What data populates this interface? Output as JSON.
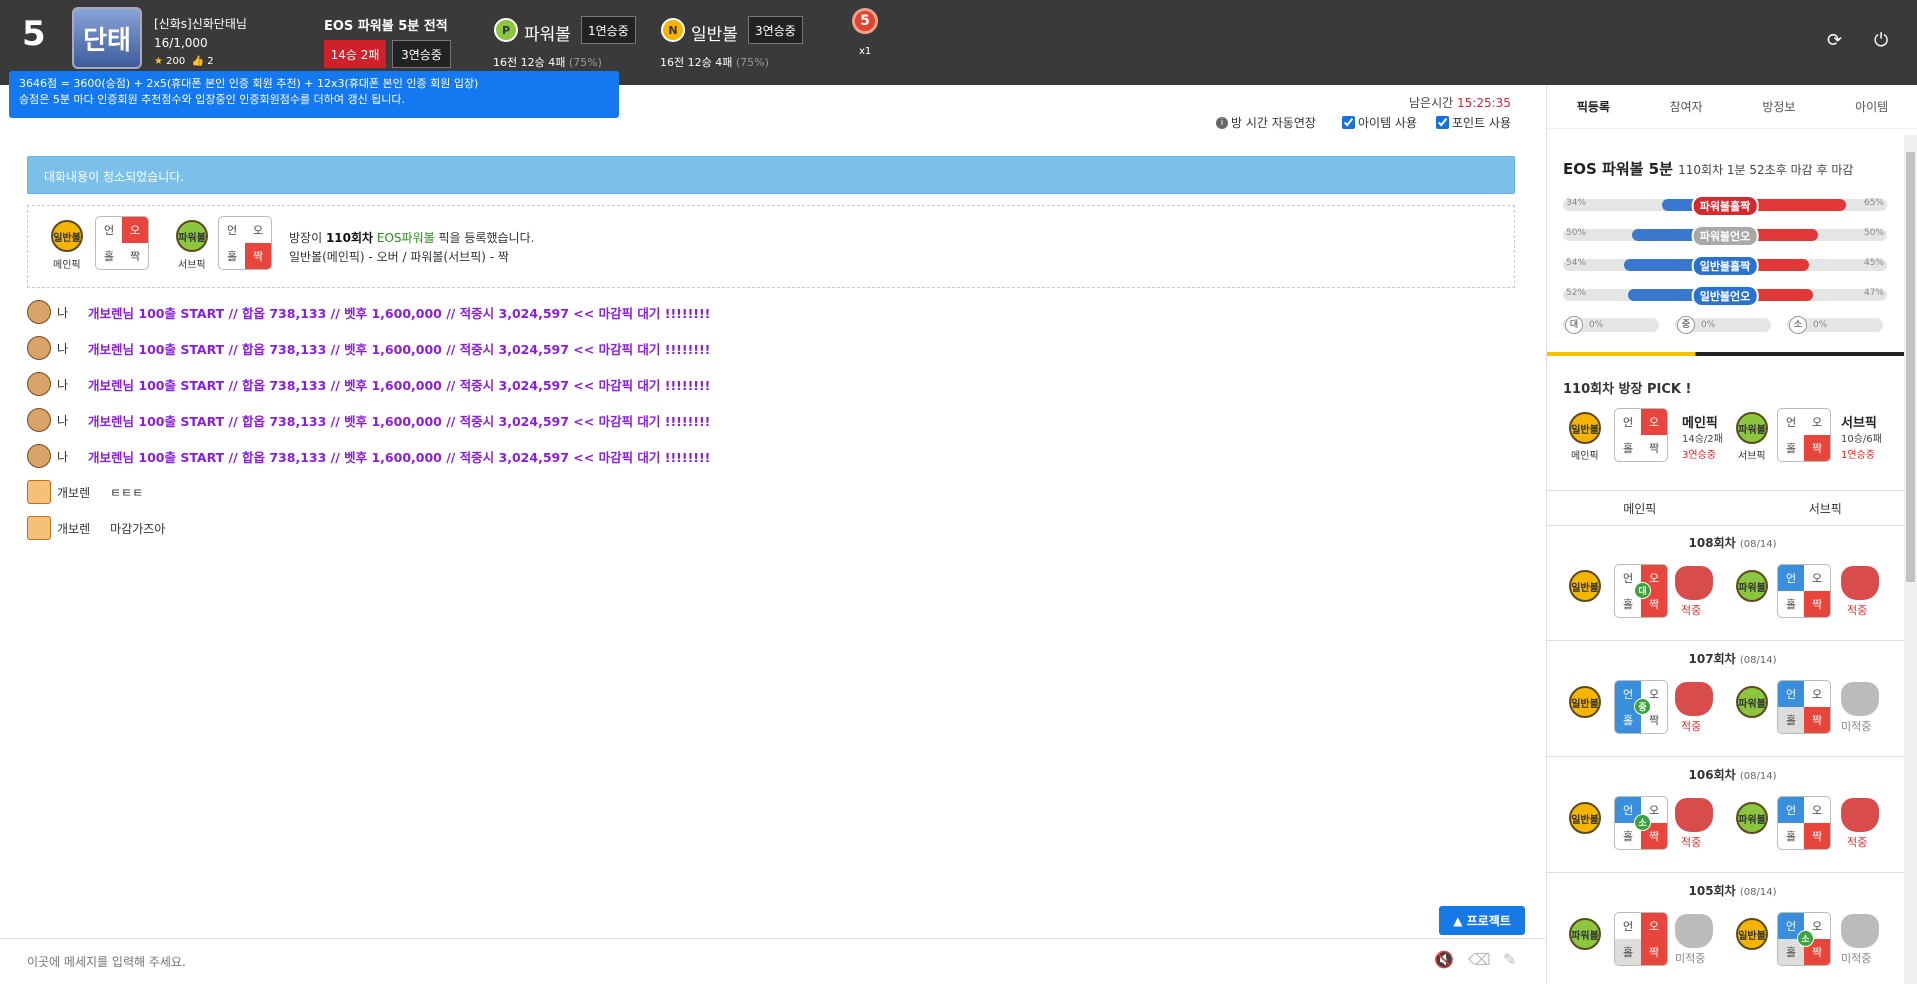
{
  "header": {
    "room_number": "5",
    "room_logo_text": "단태",
    "room_name": "[신화s]신화단태님",
    "member_count": "16/1,000",
    "stars": "200",
    "likes": "2",
    "record_title": "EOS 파워볼 5분 전적",
    "record_win_loss": "14승 2패",
    "record_streak": "3연승중",
    "powerball": {
      "icon": "P",
      "label": "파워볼",
      "streak": "1연승중",
      "record": "16전 12승 4패",
      "pct": "(75%)"
    },
    "normalball": {
      "icon": "N",
      "label": "일반볼",
      "streak": "3연승중",
      "record": "16전 12승 4패",
      "pct": "(75%)"
    },
    "medal_number": "5",
    "medal_count": "x1",
    "refresh_icon": "refresh-icon",
    "power_icon": "power-icon"
  },
  "tooltip": {
    "line1": "3646점 = 3600(승점) + 2x5(휴대폰 본인 인증 회원 추천) + 12x3(휴대폰 본인 인증 회원 입장)",
    "line2": "승점은 5분 마다 인증회원 추천점수와 입장중인 인증회원점수를 더하여 갱신 됩니다."
  },
  "subbar": {
    "time_label": "남은시간",
    "time_value": "15:25:35",
    "auto_extend": "방 시간 자동연장",
    "item_use": "아이템 사용",
    "point_use": "포인트 사용"
  },
  "chat": {
    "notice": "대화내용이 청소되었습니다.",
    "pick_box": {
      "main_tag": "일반볼",
      "main_caption": "메인픽",
      "sub_tag": "파워볼",
      "sub_caption": "서브픽",
      "grid_labels": [
        "언",
        "오",
        "홀",
        "짝"
      ],
      "msg_prefix": "방장이 ",
      "msg_round": "110회차",
      "msg_game": "EOS파워볼",
      "msg_suffix": " 픽을 등록했습니다.",
      "msg_line2": "일반볼(메인픽) - 오버 / 파워볼(서브픽) - 짝"
    },
    "messages": [
      {
        "nick": "나",
        "text": "개보렌님 100출 START // 합옵 738,133 // 벳후 1,600,000 // 적중시 3,024,597 << 마감픽 대기 !!!!!!!!",
        "style": "purple"
      },
      {
        "nick": "나",
        "text": "개보렌님 100출 START // 합옵 738,133 // 벳후 1,600,000 // 적중시 3,024,597 << 마감픽 대기 !!!!!!!!",
        "style": "purple"
      },
      {
        "nick": "나",
        "text": "개보렌님 100출 START // 합옵 738,133 // 벳후 1,600,000 // 적중시 3,024,597 << 마감픽 대기 !!!!!!!!",
        "style": "purple"
      },
      {
        "nick": "나",
        "text": "개보렌님 100출 START // 합옵 738,133 // 벳후 1,600,000 // 적중시 3,024,597 << 마감픽 대기 !!!!!!!!",
        "style": "purple"
      },
      {
        "nick": "나",
        "text": "개보렌님 100출 START // 합옵 738,133 // 벳후 1,600,000 // 적중시 3,024,597 << 마감픽 대기 !!!!!!!!",
        "style": "purple"
      },
      {
        "nick": "개보렌",
        "text": "ㅌㅌㅌ",
        "style": "normal"
      },
      {
        "nick": "개보렌",
        "text": "마감가즈아",
        "style": "normal"
      }
    ],
    "project_button": "▲ 프로젝트",
    "input_placeholder": "이곳에 메세지를 입력해 주세요."
  },
  "right_panel": {
    "tabs": [
      "픽등록",
      "참여자",
      "방정보",
      "아이템"
    ],
    "active_tab": "픽등록",
    "game_title": "EOS 파워볼 5분",
    "game_sub": "110회차 1분 52초후 마감 후 마감",
    "bars": [
      {
        "label": "파워볼홀짝",
        "left_pct": 34,
        "right_pct": 65,
        "left": "34%",
        "right": "65%",
        "color": "#d8282e"
      },
      {
        "label": "파워볼언오",
        "left_pct": 50,
        "right_pct": 50,
        "left": "50%",
        "right": "50%",
        "color": "#a8a8a8"
      },
      {
        "label": "일반볼홀짝",
        "left_pct": 54,
        "right_pct": 45,
        "left": "54%",
        "right": "45%",
        "color": "#2a72d0"
      },
      {
        "label": "일반볼언오",
        "left_pct": 52,
        "right_pct": 47,
        "left": "52%",
        "right": "47%",
        "color": "#2a72d0"
      }
    ],
    "mini_bars": [
      {
        "icon": "대",
        "value": "0%"
      },
      {
        "icon": "중",
        "value": "0%"
      },
      {
        "icon": "소",
        "value": "0%"
      }
    ],
    "owner_pick_title": "110회차 방장 PICK !",
    "owner_main": {
      "tag": "일반볼",
      "caption": "메인픽",
      "name": "메인픽",
      "record": "14승/2패",
      "streak": "3연승중"
    },
    "owner_sub": {
      "tag": "파워볼",
      "caption": "서브픽",
      "name": "서브픽",
      "record": "10승/6패",
      "streak": "1연승중"
    },
    "pick_head": [
      "메인픽",
      "서브픽"
    ],
    "rounds": [
      {
        "title": "108회차",
        "date": "(08/14)",
        "main_tag": "일반볼",
        "main_badge": "대",
        "main_result": "적중",
        "sub_tag": "파워볼",
        "sub_result": "적중"
      },
      {
        "title": "107회차",
        "date": "(08/14)",
        "main_tag": "일반볼",
        "main_badge": "중",
        "main_result": "적중",
        "sub_tag": "파워볼",
        "sub_result": "미적중"
      },
      {
        "title": "106회차",
        "date": "(08/14)",
        "main_tag": "일반볼",
        "main_badge": "소",
        "main_result": "적중",
        "sub_tag": "파워볼",
        "sub_result": "적중"
      },
      {
        "title": "105회차",
        "date": "(08/14)",
        "main_tag": "파워볼",
        "main_badge": "",
        "main_result": "미적중",
        "sub_tag": "일반볼",
        "sub_badge": "소",
        "sub_result": "미적중"
      }
    ]
  }
}
